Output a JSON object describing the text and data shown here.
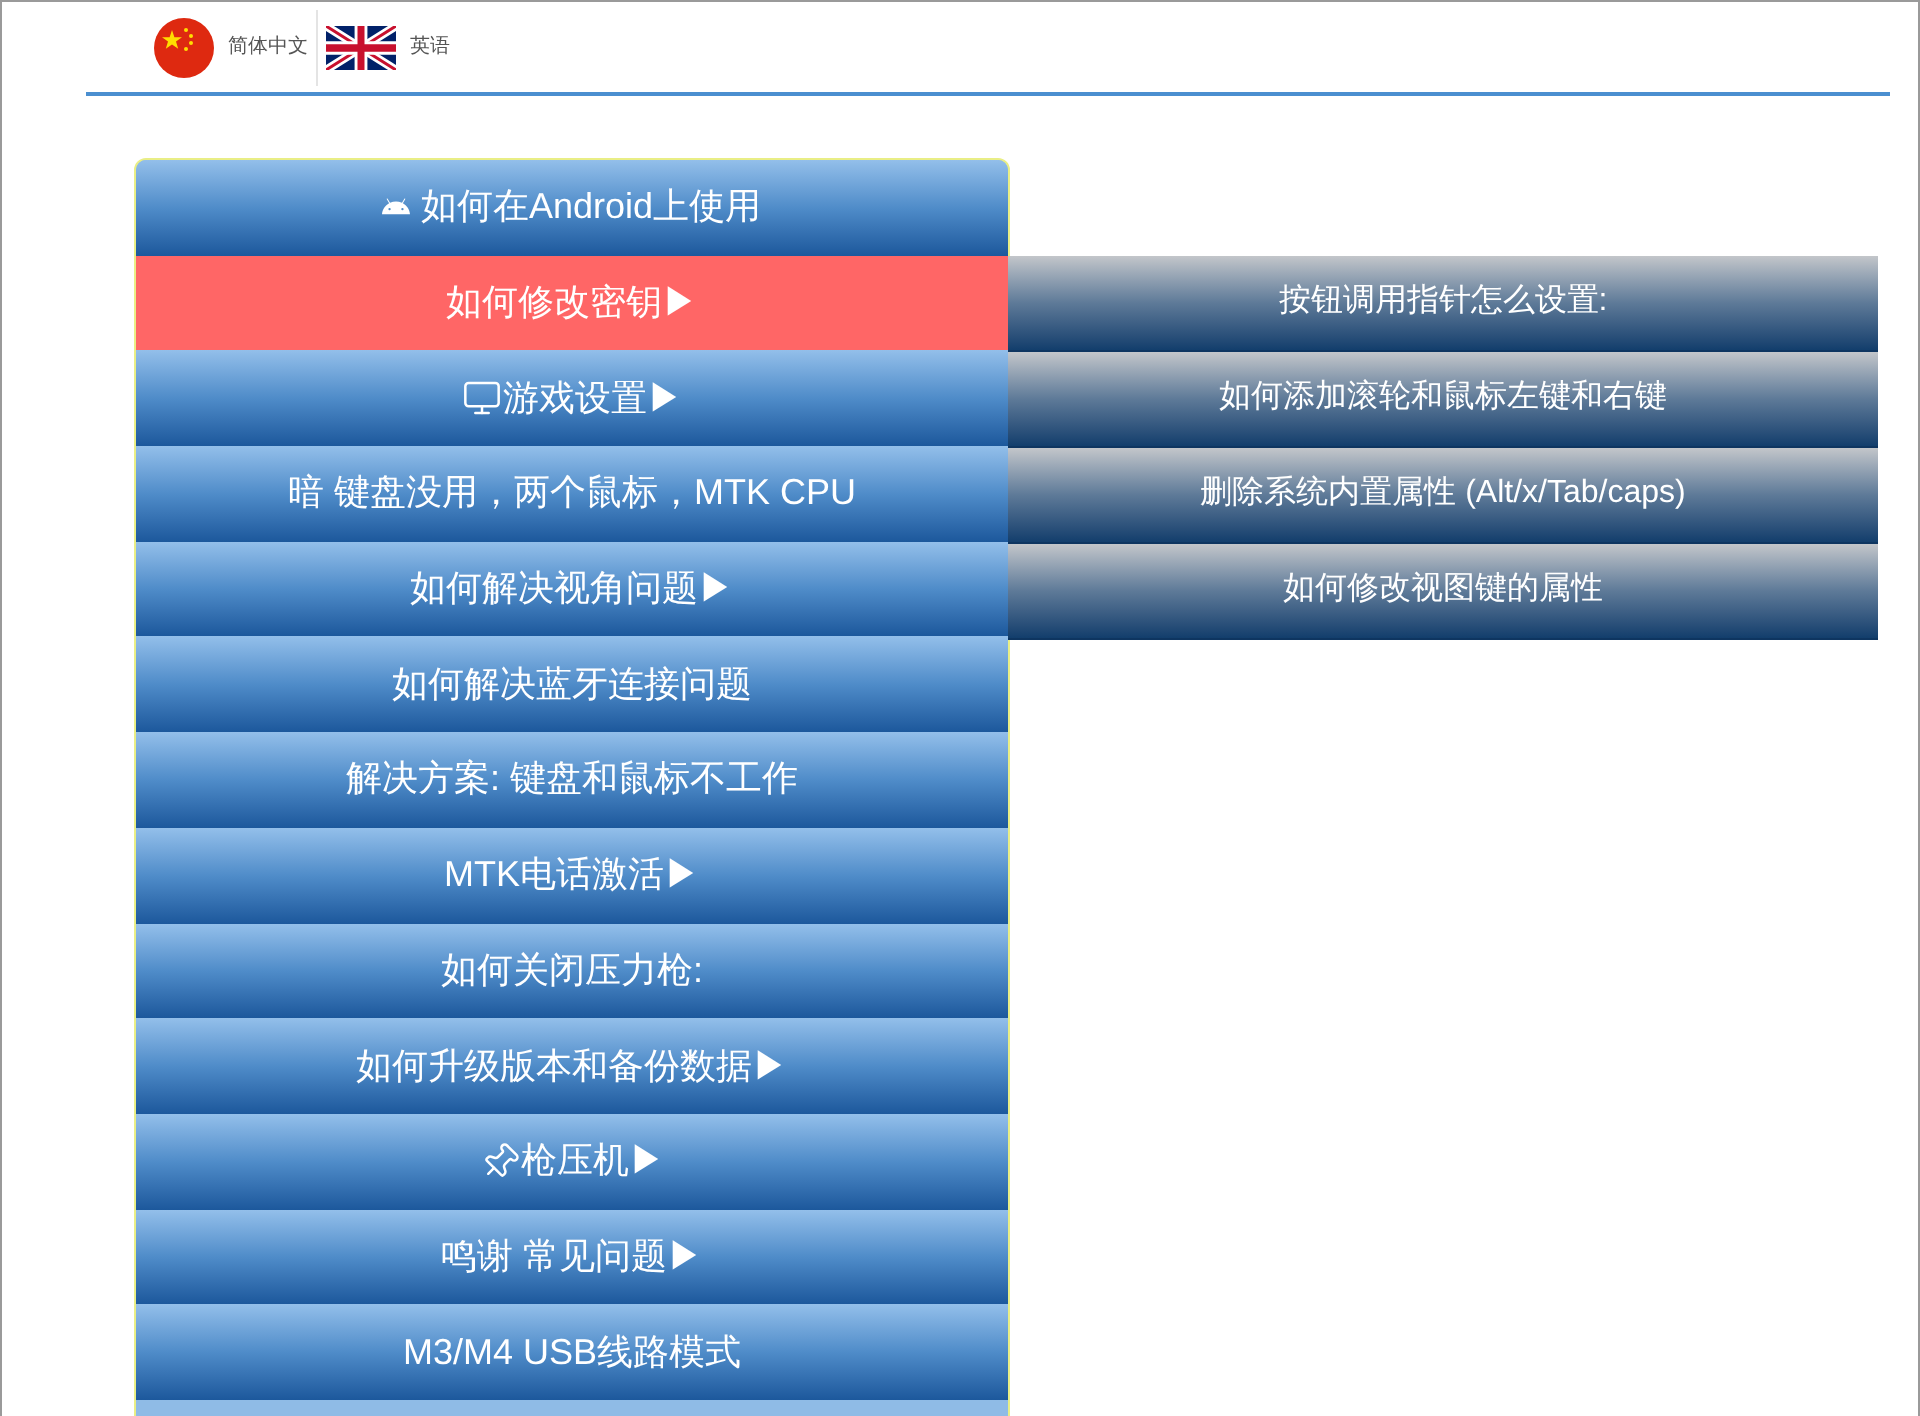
{
  "languages": [
    {
      "label": "简体中文",
      "kind": "cn"
    },
    {
      "label": "英语",
      "kind": "uk"
    }
  ],
  "menu": {
    "items": [
      {
        "label": "如何在Android上使用",
        "kind": "android",
        "selected": false
      },
      {
        "label": "如何修改密钥▶",
        "kind": "text",
        "selected": true,
        "submenu": [
          {
            "label": "按钮调用指针怎么设置:"
          },
          {
            "label": "如何添加滚轮和鼠标左键和右键"
          },
          {
            "label": "删除系统内置属性 (Alt/x/Tab/caps)"
          },
          {
            "label": "如何修改视图键的属性"
          }
        ]
      },
      {
        "label": "游戏设置▶",
        "kind": "screen",
        "selected": false
      },
      {
        "label": "暗 键盘没用，两个鼠标，MTK CPU",
        "kind": "text",
        "selected": false
      },
      {
        "label": "如何解决视角问题▶",
        "kind": "text",
        "selected": false
      },
      {
        "label": "如何解决蓝牙连接问题",
        "kind": "text",
        "selected": false
      },
      {
        "label": "解决方案: 键盘和鼠标不工作",
        "kind": "text",
        "selected": false
      },
      {
        "label": "MTK电话激活▶",
        "kind": "text",
        "selected": false
      },
      {
        "label": "如何关闭压力枪:",
        "kind": "text",
        "selected": false
      },
      {
        "label": "如何升级版本和备份数据▶",
        "kind": "text",
        "selected": false
      },
      {
        "label": "枪压机▶",
        "kind": "pin",
        "selected": false
      },
      {
        "label": "鸣谢 常见问题▶",
        "kind": "text",
        "selected": false
      },
      {
        "label": "M3/M4 USB线路模式",
        "kind": "text",
        "selected": false
      }
    ]
  }
}
